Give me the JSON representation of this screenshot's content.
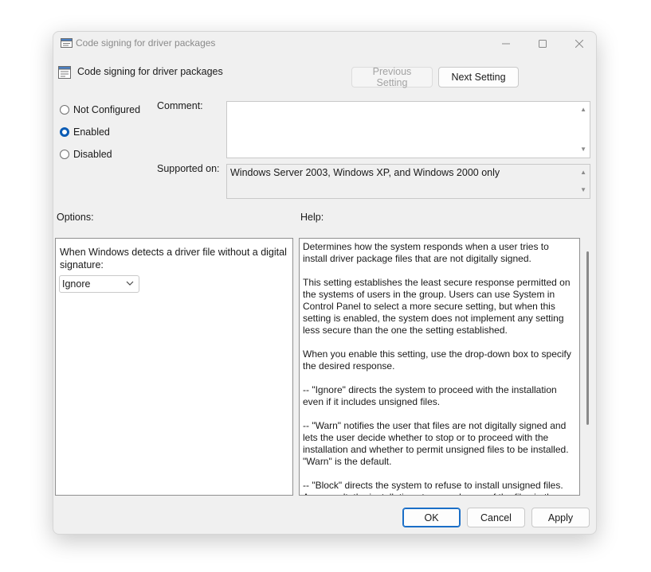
{
  "window": {
    "title": "Code signing for driver packages",
    "controls": {
      "minimize": "—",
      "maximize": "☐",
      "close": "✕"
    }
  },
  "header": {
    "title": "Code signing for driver packages",
    "previous_label": "Previous Setting",
    "next_label": "Next Setting"
  },
  "state": {
    "options": [
      {
        "label": "Not Configured",
        "selected": false
      },
      {
        "label": "Enabled",
        "selected": true
      },
      {
        "label": "Disabled",
        "selected": false
      }
    ]
  },
  "comment": {
    "label": "Comment:",
    "value": ""
  },
  "supported": {
    "label": "Supported on:",
    "value": "Windows Server 2003, Windows XP, and Windows 2000 only"
  },
  "options_section": {
    "label": "Options:",
    "description": "When Windows detects a driver file without a digital signature:",
    "select_value": "Ignore"
  },
  "help_section": {
    "label": "Help:",
    "paragraphs": [
      "Determines how the system responds when a user tries to install driver package files that are not digitally signed.",
      "This setting establishes the least secure response permitted on the systems of users in the group. Users can use System in Control Panel to select a more secure setting, but when this setting is enabled, the system does not implement any setting less secure than the one the setting established.",
      "When you enable this setting, use the drop-down box to specify the desired response.",
      "--   \"Ignore\" directs the system to proceed with the installation even if it includes unsigned files.",
      "--   \"Warn\" notifies the user that files are not digitally signed and lets the user decide whether to stop or to proceed with the installation and whether to permit unsigned files to be installed. \"Warn\" is the default.",
      "--   \"Block\" directs the system to refuse to install unsigned files. As a result, the installation stops, and none of the files in the"
    ]
  },
  "footer": {
    "ok_label": "OK",
    "cancel_label": "Cancel",
    "apply_label": "Apply"
  },
  "colors": {
    "accent": "#0b5cb5",
    "window_bg": "#f0f0f0",
    "panel_border": "#8f8f8f"
  }
}
